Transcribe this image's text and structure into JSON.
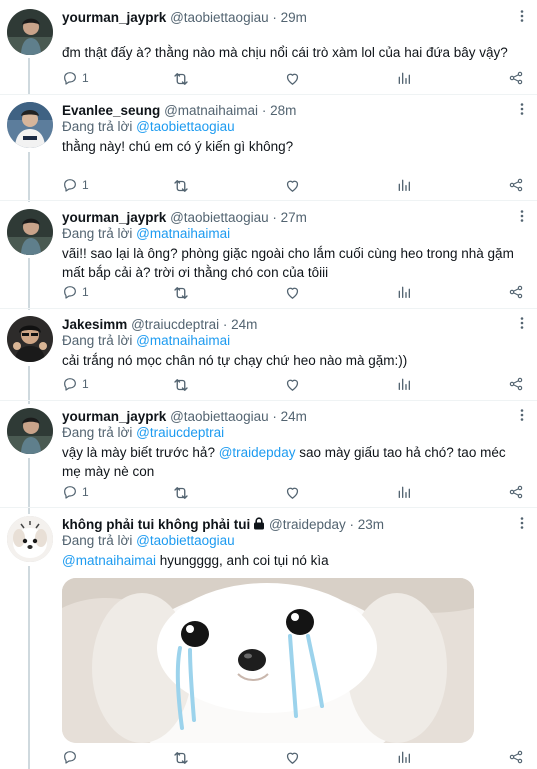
{
  "tweets": [
    {
      "name": "yourman_jayprk",
      "handle": "@taobiettaogiau",
      "time": "29m",
      "replying_label": "",
      "replying_to": "",
      "text": "đm thật đấy à? thằng nào mà chịu nổi cái trò xàm lol của hai đứa bây vậy?",
      "reply_count": "1"
    },
    {
      "name": "Evanlee_seung",
      "handle": "@matnaihaimai",
      "time": "28m",
      "replying_label": "Đang trả lời",
      "replying_to": "@taobiettaogiau",
      "text": "thằng này! chú em có ý kiến gì không?",
      "reply_count": "1"
    },
    {
      "name": "yourman_jayprk",
      "handle": "@taobiettaogiau",
      "time": "27m",
      "replying_label": "Đang trả lời",
      "replying_to": "@matnaihaimai",
      "text": "vãi!! sao lại là ông? phòng giặc ngoài cho lắm cuối cùng heo trong nhà gặm mất bắp cải à? trời ơi thằng chó con của tôiii",
      "reply_count": "1"
    },
    {
      "name": "Jakesimm",
      "handle": "@traiucdeptrai",
      "time": "24m",
      "replying_label": "Đang trả lời",
      "replying_to": "@matnaihaimai",
      "text": "cải trắng nó mọc chân nó tự chạy chứ heo nào mà gặm:))",
      "reply_count": "1"
    },
    {
      "name": "yourman_jayprk",
      "handle": "@taobiettaogiau",
      "time": "24m",
      "replying_label": "Đang trả lời",
      "replying_to": "@traiucdeptrai",
      "text_before": "vậy là mày biết trước hả? ",
      "text_mention": "@traidepday",
      "text_after": " sao mày giấu tao hả chó? tao méc mẹ mày nè con",
      "reply_count": "1"
    },
    {
      "name": "không phải tui không phải tui",
      "handle": "@traidepday",
      "time": "23m",
      "replying_label": "Đang trả lời",
      "replying_to": "@taobiettaogiau",
      "text_mention": "@matnaihaimai",
      "text_after": " hyungggg, anh coi tụi nó kìa",
      "media": "crying white puppy photo"
    }
  ],
  "dot": "·",
  "colors": {
    "accent": "#1d9bf0",
    "secondary_text": "#536471",
    "divider": "#eff3f4"
  },
  "icons": [
    "reply-icon",
    "retweet-icon",
    "like-icon",
    "stats-icon",
    "share-icon",
    "more-icon",
    "lock-icon"
  ]
}
